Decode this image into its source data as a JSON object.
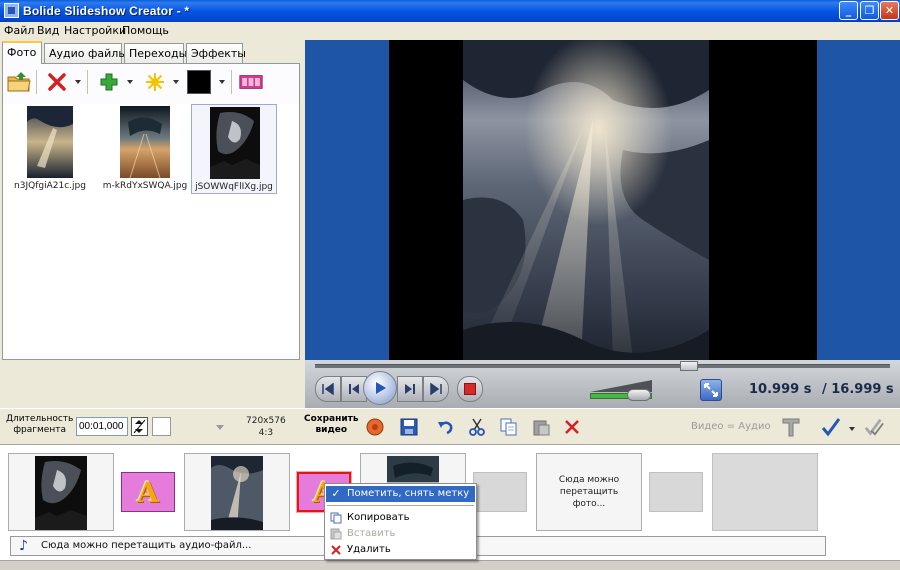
{
  "window": {
    "title": "Bolide Slideshow Creator - *",
    "controls": {
      "minimize": "_",
      "maximize": "❐",
      "close": "✕"
    }
  },
  "menu": [
    "Файл",
    "Вид",
    "Настройки",
    "Помощь"
  ],
  "tabs": [
    "Фото",
    "Аудио файлы",
    "Переходы",
    "Эффекты"
  ],
  "active_tab": "Фото",
  "photo_toolbar": {
    "icons": [
      "open-folder-icon",
      "delete-icon",
      "add-icon",
      "effects-star-icon",
      "color-picker-icon",
      "film-icon"
    ],
    "colors": {
      "delete": "#D42020",
      "add": "#38A83A",
      "star": "#F5C400",
      "color_box": "#000000",
      "film": "#D23A8E"
    }
  },
  "photos": [
    {
      "name": "n3JQfgiA21c.jpg",
      "selected": false
    },
    {
      "name": "m-kRdYxSWQA.jpg",
      "selected": false
    },
    {
      "name": "jSOWWqFlIXg.jpg",
      "selected": true
    }
  ],
  "player": {
    "seek_position": 0.65,
    "volume_level": 0.6,
    "time_current": "10.999 s",
    "time_total": "/ 16.999 s"
  },
  "bottom_toolbar": {
    "duration_label": "Длительность\nфрагмента",
    "duration_value": "00:01,000",
    "resolution": "720x576\n4:3",
    "save_video_label": "Сохранить\nвидео",
    "video_audio_label": "Видео = Аудио",
    "icons": [
      "record-icon",
      "save-disk-icon",
      "undo-icon",
      "cut-icon",
      "copy-icon",
      "paste-icon",
      "delete-x-icon",
      "text-icon",
      "check-icon",
      "check-all-icon"
    ]
  },
  "timeline": {
    "transition_letter": "A",
    "drop_photo_text": "Сюда можно\nперетащить\nфото...",
    "audio_drop_text": "Сюда можно перетащить аудио-файл..."
  },
  "context_menu": {
    "items": [
      {
        "label": "Пометить, снять метку",
        "icon": "check-icon",
        "highlighted": true,
        "disabled": false
      },
      {
        "label": "Копировать",
        "icon": "copy-icon",
        "highlighted": false,
        "disabled": false
      },
      {
        "label": "Вставить",
        "icon": "paste-icon",
        "highlighted": false,
        "disabled": true
      },
      {
        "label": "Удалить",
        "icon": "delete-icon",
        "highlighted": false,
        "disabled": false
      }
    ]
  },
  "colors": {
    "title_bar": "#0A5FD8",
    "preview_bg": "#1E55A5",
    "selection": "#316AC5",
    "transition_tile": "#E57BDB"
  }
}
